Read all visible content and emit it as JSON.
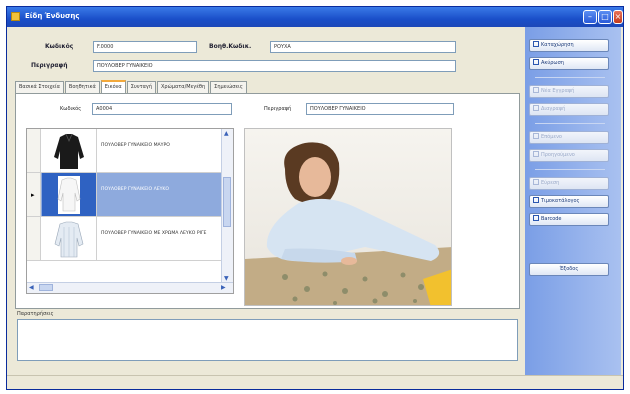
{
  "window": {
    "title": "Είδη Ένδυσης"
  },
  "header": {
    "code_label": "Κωδικός",
    "code_value": "F.0000",
    "help_code_label": "Βοηθ.Κωδικ.",
    "help_code_value": "ΡΟΥΧΑ",
    "description_label": "Περιγραφή",
    "description_value": "ΠΟΥΛΟΒΕΡ ΓΥΝΑΙΚΕΙΟ"
  },
  "tabs": [
    {
      "label": "Βασικά Στοιχεία"
    },
    {
      "label": "Βοηθητικά"
    },
    {
      "label": "Εικόνα"
    },
    {
      "label": "Συνταγή"
    },
    {
      "label": "Χρώματα/Μεγέθη"
    },
    {
      "label": "Σημειώσεις"
    }
  ],
  "active_tab": 2,
  "image_tab": {
    "code_label": "Κωδικός",
    "code_value": "A0004",
    "desc_label": "Περιγραφή",
    "desc_value": "ΠΟΥΛΟΒΕΡ ΓΥΝΑΙΚΕΙΟ",
    "rows": [
      {
        "description": "ΠΟΥΛΟΒΕΡ ΓΥΝΑΙΚΕΙΟ ΜΑΥΡΟ",
        "color": "#1a1a1a",
        "selected": false
      },
      {
        "description": "ΠΟΥΛΟΒΕΡ ΓΥΝΑΙΚΕΙΟ ΛΕΥΚΟ",
        "color": "#f4f4f4",
        "selected": true
      },
      {
        "description": "ΠΟΥΛΟΒΕΡ ΓΥΝΑΙΚΕΙΟ ΜΕ ΧΡΩΜΑ ΛΕΥΚΟ ΡΙΓΕ",
        "color": "#dfe6ee",
        "selected": false
      }
    ]
  },
  "notes_label": "Παρατηρήσεις",
  "sidebar": {
    "buttons": [
      {
        "label": "Καταχώρηση",
        "icon": "save-icon",
        "enabled": true
      },
      {
        "label": "Ακύρωση",
        "icon": "undo-icon",
        "enabled": true
      },
      {
        "label": "Νέα Εγγραφή",
        "icon": "new-record-icon",
        "enabled": false
      },
      {
        "label": "Διαγραφή",
        "icon": "delete-icon",
        "enabled": false
      },
      {
        "label": "Επόμενο",
        "icon": "next-icon",
        "enabled": false
      },
      {
        "label": "Προηγούμενο",
        "icon": "previous-icon",
        "enabled": false
      },
      {
        "label": "Εύρεση",
        "icon": "find-icon",
        "enabled": false
      },
      {
        "label": "Τιμοκατάλογος",
        "icon": "pricelist-icon",
        "enabled": true
      },
      {
        "label": "Barcode",
        "icon": "barcode-icon",
        "enabled": true
      },
      {
        "label": "Έξοδος",
        "icon": "",
        "enabled": true
      }
    ]
  },
  "colors": {
    "titlebar": "#1a4fc9",
    "sidebar": "#7a9ee6",
    "selection": "#8eaadd",
    "window_bg": "#ece9d8"
  }
}
